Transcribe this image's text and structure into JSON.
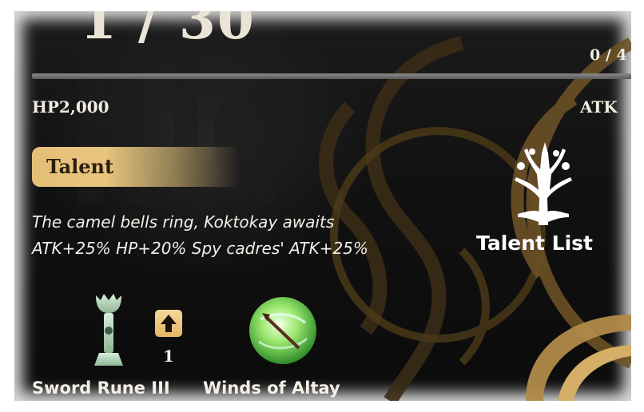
{
  "header": {
    "page_counter": "1 / 30",
    "slot_counter": "0 / 4"
  },
  "stats": {
    "hp_text": "HP2,000",
    "atk_text": "ATK"
  },
  "talent": {
    "header_label": "Talent",
    "description_line1": "The camel bells ring, Koktokay awaits",
    "description_line2": "ATK+25% HP+20% Spy cadres' ATK+25%"
  },
  "talent_list_button": {
    "label": "Talent List",
    "icon": "tree-icon"
  },
  "items": [
    {
      "name": "Sword Rune III",
      "icon": "sword-rune-icon",
      "level": "1",
      "upgrade_icon": "arrow-up-icon"
    },
    {
      "name": "Winds of Altay",
      "icon": "winds-orb-icon"
    }
  ],
  "colors": {
    "gold": "#e8c67f",
    "text": "#f2efe8",
    "background": "#111111"
  }
}
